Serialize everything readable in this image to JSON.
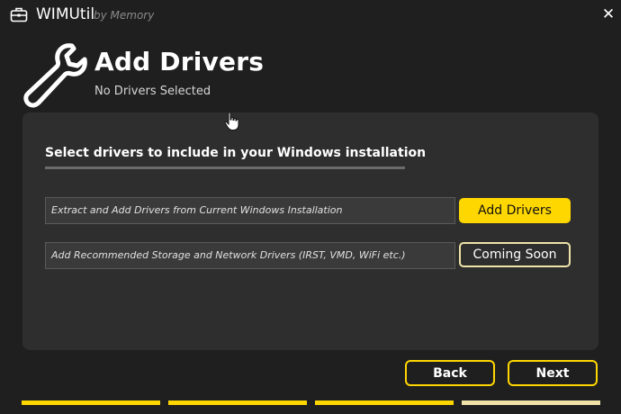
{
  "titlebar": {
    "app_name": "WIMUtil",
    "by_line": "by Memory",
    "close_glyph": "✕",
    "icons": {
      "app": "toolbox-icon",
      "close": "close-icon"
    }
  },
  "header": {
    "icon": "wrench-icon",
    "title": "Add Drivers",
    "subtitle": "No Drivers Selected"
  },
  "panel": {
    "heading": "Select drivers to include in your Windows installation",
    "rows": [
      {
        "field_text": "Extract and Add Drivers from Current Windows Installation",
        "button_label": "Add Drivers"
      },
      {
        "field_text": "Add Recommended Storage and Network Drivers (IRST, VMD, WiFi etc.)",
        "button_label": "Coming Soon"
      }
    ]
  },
  "footer": {
    "back_label": "Back",
    "next_label": "Next"
  },
  "progress": {
    "steps": 4,
    "colors": {
      "active": "#ffd700",
      "current": "#f0e2a8"
    }
  },
  "theme": {
    "accent": "#ffd700",
    "background": "#1f1f1f",
    "panel": "#2e2e2e"
  }
}
